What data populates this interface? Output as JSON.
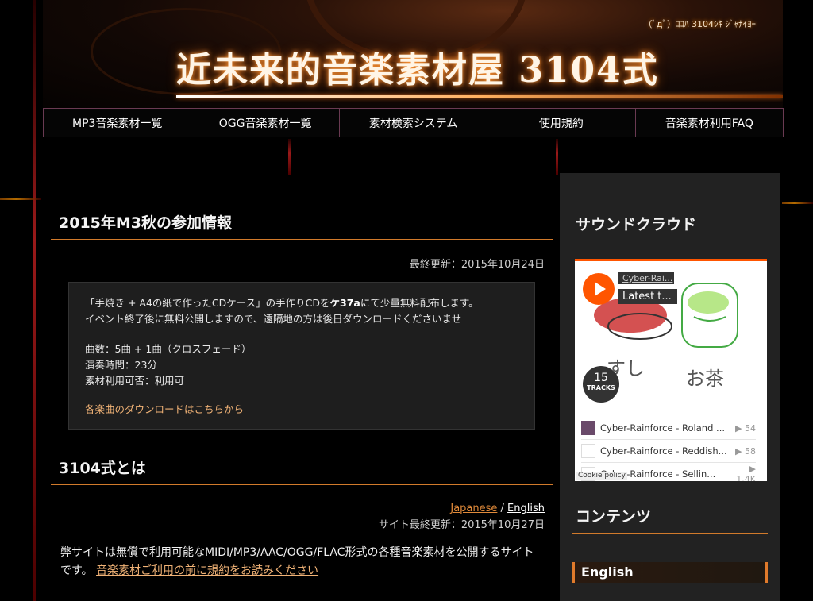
{
  "header": {
    "title": "近未来的音楽素材屋 3104式",
    "subtitle": "（ﾟдﾟ）ｺｺﾊ 3104ｼｷ ｼﾞｬﾅｲﾖｰ"
  },
  "nav": {
    "items": [
      "MP3音楽素材一覧",
      "OGG音楽素材一覧",
      "素材検索システム",
      "使用規約",
      "音楽素材利用FAQ"
    ]
  },
  "main": {
    "m3": {
      "title": "2015年M3秋の参加情報",
      "updated": "最終更新：2015年10月24日",
      "line1_pre": "「手焼き + A4の紙で作ったCDケース」の手作りCDを",
      "line1_hl": "ケ37a",
      "line1_post": "にて少量無料配布します。",
      "line2": "イベント終了後に無料公開しますので、遠隔地の方は後日ダウンロードくださいませ",
      "tracks": "曲数：5曲 + 1曲（クロスフェード）",
      "duration": "演奏時間：23分",
      "usage": "素材利用可否：利用可",
      "download_link": "各楽曲のダウンロードはこちらから"
    },
    "about": {
      "title": "3104式とは",
      "lang_ja": "Japanese",
      "lang_sep": " / ",
      "lang_en": "English",
      "updated": "サイト最終更新：2015年10月27日",
      "intro": "弊サイトは無償で利用可能なMIDI/MP3/AAC/OGG/FLAC形式の各種音楽素材を公開するサイトです。",
      "intro_link": "音楽素材ご利用の前に規約をお読みください"
    }
  },
  "sidebar": {
    "soundcloud_title": "サウンドクラウド",
    "widget": {
      "user": "Cyber-Rai...",
      "playlist": "Latest t...",
      "track_count": "15",
      "track_label": "TRACKS",
      "doodle_left": "すし",
      "doodle_right": "お茶",
      "tracks": [
        {
          "title": "Cyber-Rainforce - Roland ...",
          "plays": "▶ 54"
        },
        {
          "title": "Cyber-Rainforce - Reddish...",
          "plays": "▶ 58"
        },
        {
          "title": "Cyber-Rainforce - Sellin...",
          "plays": "▶ 1.4K"
        }
      ],
      "cookie": "Cookie policy"
    },
    "contents_title": "コンテンツ",
    "english_link": "English"
  },
  "colors": {
    "accent": "#d17a2b",
    "link": "#f0b276",
    "soundcloud": "#ff5500"
  }
}
